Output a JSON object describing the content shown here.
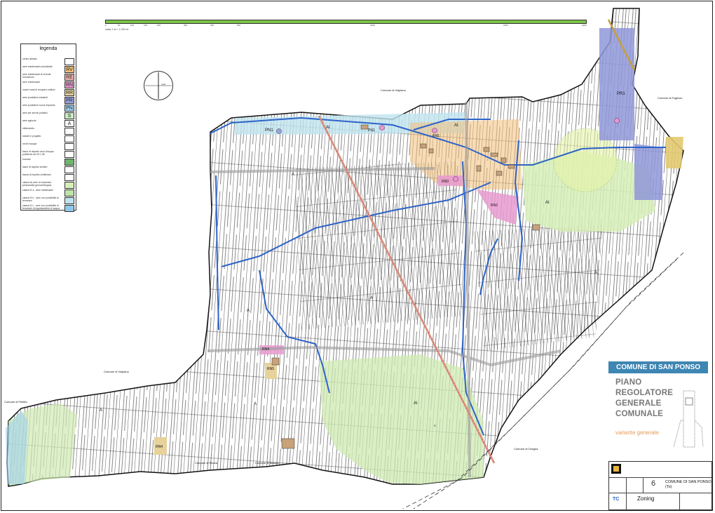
{
  "legend": {
    "title": "legenda",
    "items": [
      {
        "label": "centro abitato",
        "code": "",
        "color": "#ffffff"
      },
      {
        "label": "aree residenziali consolidate",
        "code": "RV",
        "color": "#f2c07a"
      },
      {
        "label": "aree residenziali di recente formazione",
        "code": "RE",
        "color": "#f3b3ae"
      },
      {
        "label": "aree residenziali",
        "code": "RN",
        "color": "#e79ad0"
      },
      {
        "label": "nuclei rurali di recupero edilizio",
        "code": "RR",
        "color": "#e6d29a"
      },
      {
        "label": "aree produttive esistenti",
        "code": "PR",
        "color": "#9aa3df"
      },
      {
        "label": "aree produttive nuove impianto",
        "code": "PN",
        "color": "#9fd0ef"
      },
      {
        "label": "aree per servizi pubblici",
        "code": "S",
        "color": "#c9ecc1"
      },
      {
        "label": "aree agricole",
        "code": "A",
        "color": "#ffffff"
      },
      {
        "label": "elettrodotto",
        "code": "",
        "color": "#ffffff"
      },
      {
        "label": "strade in progetto",
        "code": "",
        "color": "#ffffff"
      },
      {
        "label": "rondi d'acqua",
        "code": "",
        "color": "#ffffff"
      },
      {
        "label": "fasce di rispetto corsi d'acqua pubbliche art.29 L.56",
        "code": "",
        "color": "#ffffff"
      },
      {
        "label": "boscato",
        "code": "",
        "color": "#6fb56c"
      },
      {
        "label": "fasce di rispetto cimiteri",
        "code": "",
        "color": "#ffffff"
      },
      {
        "label": "fascia di rispetto cimiteriale",
        "code": "",
        "color": "#ffffff"
      },
      {
        "label": "classe IIa aree di moderata pericolosità geomorfologica",
        "code": "",
        "color": "#d6efb6"
      },
      {
        "label": "classe III a - aree inedificabili",
        "code": "",
        "color": "#bfe5a8"
      },
      {
        "label": "classe III b - aree con possibilità di fenomeni",
        "code": "",
        "color": "#bfe3ef"
      },
      {
        "label": "classe III c - aree con possibilità di fenomeni di ingrottamento di acqua",
        "code": "",
        "color": "#8ec9ea"
      }
    ]
  },
  "scale": {
    "ticks": [
      "0",
      "50",
      "100",
      "150",
      "200",
      "300",
      "400",
      "500",
      "1000",
      "1500",
      "2000"
    ],
    "caption": "scala 1 ml = 1.000 ml"
  },
  "compass": {
    "label": "nord"
  },
  "map_labels": {
    "comune_volpiano_top": "Comune di Volpiano",
    "comune_volpiano_bottom": "Comune di Volpiano",
    "comune_foglizzo": "Comune di Foglizzo",
    "comune_feletto": "Comune di Feletto",
    "comune_rivara": "Comune di Rivara",
    "comune_busano": "Comune di Busano",
    "comune_ozegna": "Comune di Ozegna",
    "zones": [
      "PN1",
      "AI",
      "AI",
      "PN1",
      "RN1",
      "RN3",
      "RN2",
      "AI",
      "PR1",
      "A",
      "A",
      "A",
      "A",
      "A",
      "A",
      "AI",
      "RN4",
      "RN5",
      "RN4",
      "S"
    ]
  },
  "title_card": {
    "banner": "COMUNE DI SAN PONSO",
    "lines": [
      "PIANO",
      "REGOLATORE",
      "GENERALE",
      "COMUNALE"
    ],
    "subtitle": "variante generale"
  },
  "cartouche": {
    "sheet_number": "6",
    "comune": "COMUNE DI SAN PONSO",
    "province": "(To)",
    "table_title": "Zoning",
    "code": "TC"
  },
  "colors": {
    "road_blue": "#2d63c8",
    "agricultural_green": "#cfe9b2",
    "industrial": "#8f97d8",
    "residential": "#e79ad0",
    "water": "#8ec9ea",
    "scale_bar": "#7cc34a",
    "title_banner": "#3e86b3"
  }
}
